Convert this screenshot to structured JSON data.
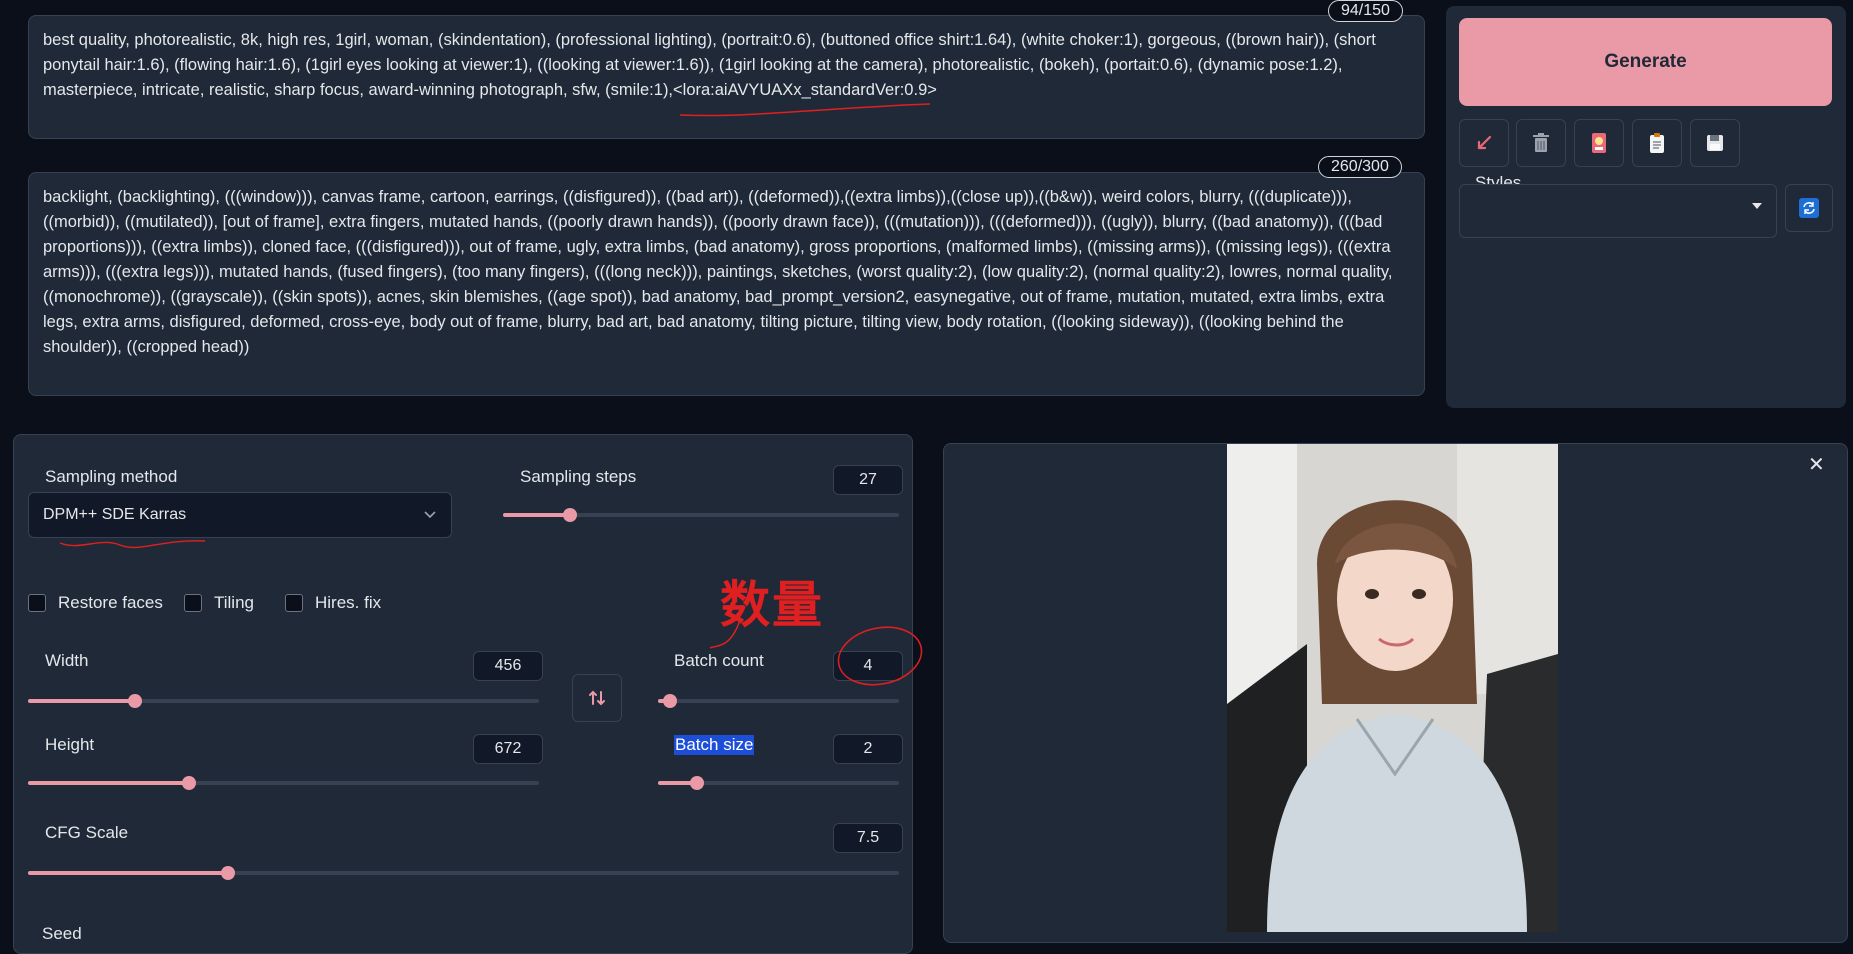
{
  "prompt": {
    "positive": "best quality, photorealistic, 8k, high res, 1girl, woman, (skindentation), (professional lighting), (portrait:0.6), (buttoned office shirt:1.64), (white choker:1), gorgeous, ((brown hair)), (short ponytail hair:1.6), (flowing hair:1.6), (1girl eyes looking at viewer:1), ((looking at viewer:1.6)), (1girl looking at the camera), photorealistic, (bokeh), (portait:0.6), (dynamic pose:1.2), masterpiece, intricate, realistic, sharp focus, award-winning photograph, sfw, (smile:1),<lora:aiAVYUAXx_standardVer:0.9>",
    "positive_counter": "94/150",
    "negative": "backlight, (backlighting), (((window))), canvas frame, cartoon, earrings, ((disfigured)), ((bad art)), ((deformed)),((extra limbs)),((close up)),((b&w)), weird colors, blurry, (((duplicate))), ((morbid)), ((mutilated)), [out of frame], extra fingers, mutated hands, ((poorly drawn hands)), ((poorly drawn face)), (((mutation))), (((deformed))), ((ugly)), blurry, ((bad anatomy)), (((bad proportions))), ((extra limbs)), cloned face, (((disfigured))), out of frame, ugly, extra limbs, (bad anatomy), gross proportions, (malformed limbs), ((missing arms)), ((missing legs)), (((extra arms))), (((extra legs))), mutated hands, (fused fingers), (too many fingers), (((long neck))), paintings, sketches, (worst quality:2), (low quality:2), (normal quality:2), lowres, normal quality, ((monochrome)), ((grayscale)), ((skin spots)), acnes, skin blemishes, ((age spot)), bad anatomy, bad_prompt_version2, easynegative, out of frame, mutation, mutated, extra limbs, extra legs, extra arms, disfigured, deformed, cross-eye, body out of frame, blurry, bad art, bad anatomy, tilting picture, tilting view, body rotation, ((looking sideway)), ((looking behind the shoulder)), ((cropped head))",
    "negative_counter": "260/300"
  },
  "actions": {
    "generate_label": "Generate",
    "tool_icons": [
      "arrow-read-icon",
      "trash-icon",
      "model-card-icon",
      "clipboard-icon",
      "save-icon"
    ],
    "styles_label": "Styles",
    "styles_value": ""
  },
  "settings": {
    "sampling_method_label": "Sampling method",
    "sampling_method_value": "DPM++ SDE Karras",
    "sampling_steps_label": "Sampling steps",
    "sampling_steps_value": "27",
    "sampling_steps_fraction": 0.17,
    "restore_faces_label": "Restore faces",
    "tiling_label": "Tiling",
    "hires_fix_label": "Hires. fix",
    "width_label": "Width",
    "width_value": "456",
    "width_fraction": 0.21,
    "height_label": "Height",
    "height_value": "672",
    "height_fraction": 0.315,
    "batch_count_label": "Batch count",
    "batch_count_value": "4",
    "batch_count_fraction": 0.05,
    "batch_size_label": "Batch size",
    "batch_size_value": "2",
    "batch_size_fraction": 0.16,
    "cfg_scale_label": "CFG Scale",
    "cfg_scale_value": "7.5",
    "cfg_scale_fraction": 0.23,
    "seed_label": "Seed"
  },
  "annotation": {
    "text": "数量",
    "color": "#e02020"
  },
  "colors": {
    "accent": "#e99aa6",
    "background": "#0b0f19",
    "panel": "#1f2937"
  }
}
